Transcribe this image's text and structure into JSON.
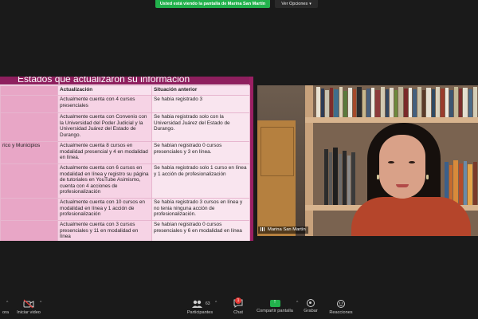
{
  "banner": {
    "sharing_text": "Usted está viendo la pantalla de Marina San Martín",
    "view_options": "Ver Opciones"
  },
  "slide": {
    "title": "Estados que actualizaron su información",
    "headers": [
      "",
      "Actualización",
      "Situación anterior"
    ],
    "rows": [
      [
        "",
        "Actualmente cuenta con 4 cursos presenciales",
        "Se había registrado 3"
      ],
      [
        "",
        "Actualmente cuenta con Convenio con la Universidad del Poder Judicial y la Universidad Juárez del Estado de Durango.",
        "Se habia registrado solo con  la Universidad Juárez del Estado de Durango."
      ],
      [
        "rico y Municipios",
        "Actualmente cuenta 8 cursos en modalidad presencial y 4 en modalidad en línea.",
        "Se habían registrado 0 cursos presenciales y 3 en línea."
      ],
      [
        "",
        "Actualmente cuenta con 6 cursos en modalidad en línea y registro su página de tutoriales en YouTube Asimismo, cuenta con 4 acciones de profesionalización",
        "Se había registrado solo 1 curso en línea y 1 acción de profesionalización"
      ],
      [
        "",
        "Actualmente cuenta con 10 cursos en modalidad en línea y 1 acción de profesionalización",
        "Se había registrado 3 cursos en línea y no tenia ninguna acción de profesionalización."
      ],
      [
        "",
        "Actualmente cuenta con 3 cursos presenciales y 11 en modalidad en línea",
        "Se habían registrado 0 cursos presenciales y 6 en modalidad en línea"
      ]
    ]
  },
  "video": {
    "participant_name": "Marina San Martín"
  },
  "toolbar": {
    "partial_left_label": "ora",
    "start_video_label": "Iniciar video",
    "participants_label": "Participantes",
    "participants_count": "63",
    "chat_label": "Chat",
    "chat_badge": "1",
    "share_label": "Compartir pantalla",
    "record_label": "Grabar",
    "reactions_label": "Reacciones"
  },
  "colors": {
    "share_green": "#22b14c",
    "slide_magenta": "#8e1f5e",
    "badge_red": "#e53935"
  }
}
